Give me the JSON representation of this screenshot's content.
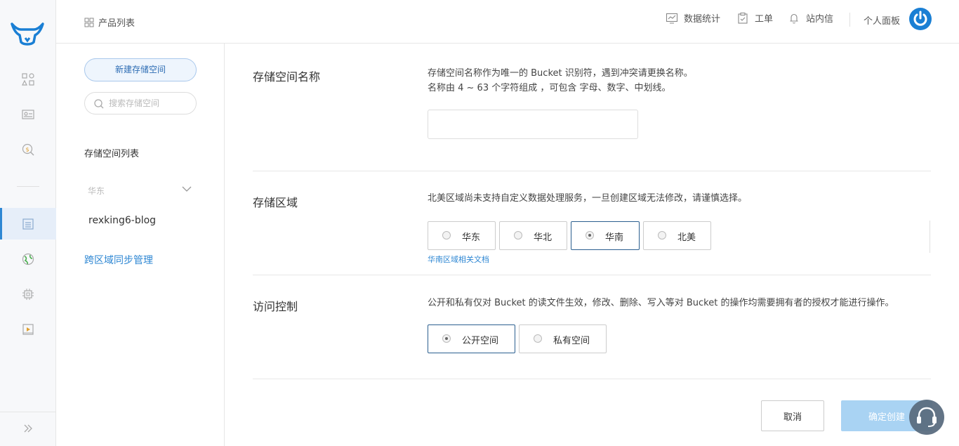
{
  "topbar": {
    "product_list": "产品列表",
    "data_stats": "数据统计",
    "tickets": "工单",
    "messages": "站内信",
    "personal_panel": "个人面板"
  },
  "sidebar": {
    "new_bucket": "新建存储空间",
    "search_placeholder": "搜索存储空间",
    "list_label": "存储空间列表",
    "region": "华东",
    "bucket_name": "rexking6-blog",
    "cross_region": "跨区域同步管理"
  },
  "form": {
    "name": {
      "title": "存储空间名称",
      "desc_line1": "存储空间名称作为唯一的 Bucket 识别符，遇到冲突请更换名称。",
      "desc_line2": "名称由 4 ~ 63 个字符组成 ，可包含 字母、数字、中划线。",
      "value": ""
    },
    "region": {
      "title": "存储区域",
      "desc": "北美区域尚未支持自定义数据处理服务，一旦创建区域无法修改，请谨慎选择。",
      "options": [
        "华东",
        "华北",
        "华南",
        "北美"
      ],
      "selected": "华南",
      "doc_link": "华南区域相关文档"
    },
    "access": {
      "title": "访问控制",
      "desc": "公开和私有仅对 Bucket 的读文件生效，修改、删除、写入等对 Bucket 的操作均需要拥有者的授权才能进行操作。",
      "options": [
        "公开空间",
        "私有空间"
      ],
      "selected": "公开空间"
    }
  },
  "actions": {
    "cancel": "取消",
    "confirm": "确定创建"
  },
  "colors": {
    "accent": "#2e87d3",
    "confirm_disabled": "#a9d3f3",
    "brand": "#1a7fd4"
  }
}
